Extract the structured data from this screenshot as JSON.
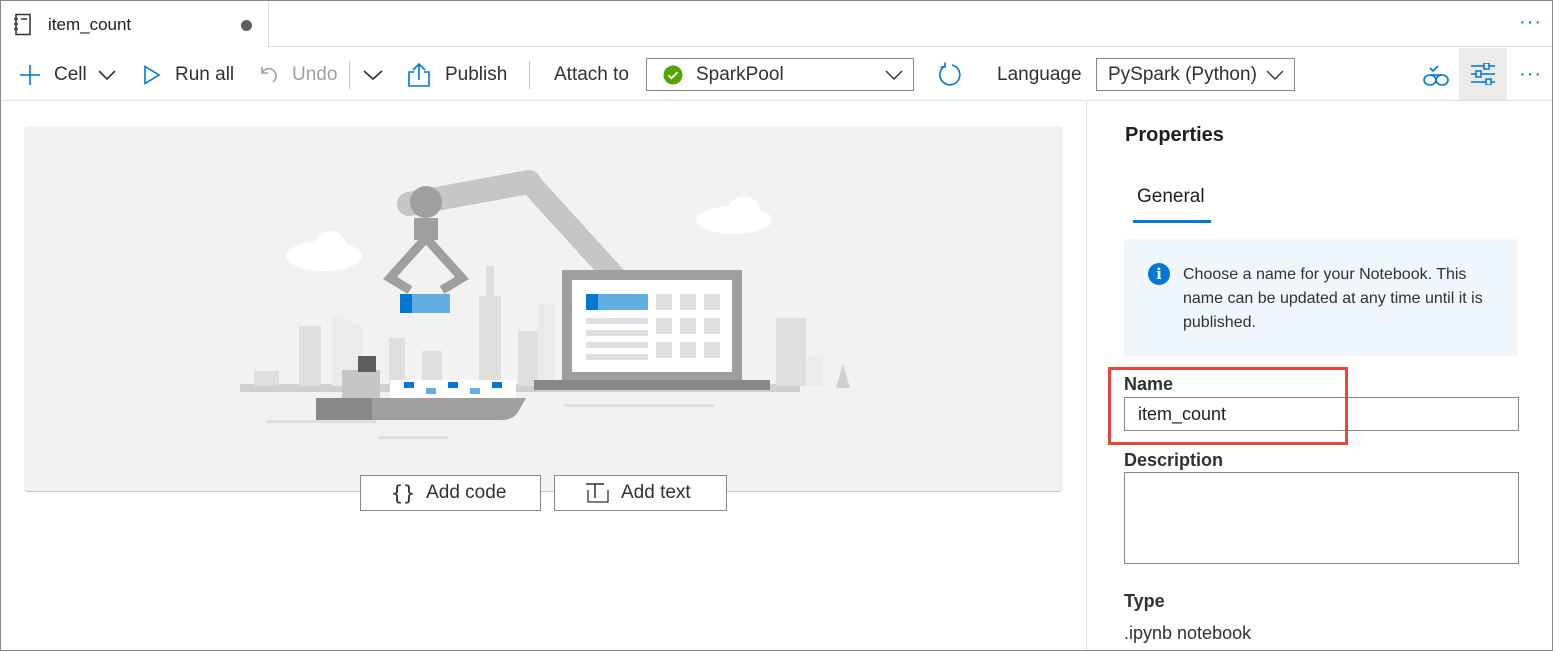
{
  "tab": {
    "title": "item_count",
    "modified": true,
    "more": "···"
  },
  "toolbar": {
    "cell_label": "Cell",
    "run_all_label": "Run all",
    "undo_label": "Undo",
    "publish_label": "Publish",
    "attach_to_label": "Attach to",
    "attach_to_value": "SparkPool",
    "attach_status_color": "#57a300",
    "language_label": "Language",
    "language_value": "PySpark (Python)",
    "more": "···"
  },
  "canvas": {
    "add_code_label": "Add code",
    "add_text_label": "Add text"
  },
  "properties": {
    "title": "Properties",
    "tab_general": "General",
    "info_text": "Choose a name for your Notebook. This name can be updated at any time until it is published.",
    "name_label": "Name",
    "name_value": "item_count",
    "description_label": "Description",
    "description_value": "",
    "type_label": "Type",
    "type_value": ".ipynb notebook"
  },
  "colors": {
    "accent": "#0078d4",
    "highlight": "#e8453c"
  }
}
